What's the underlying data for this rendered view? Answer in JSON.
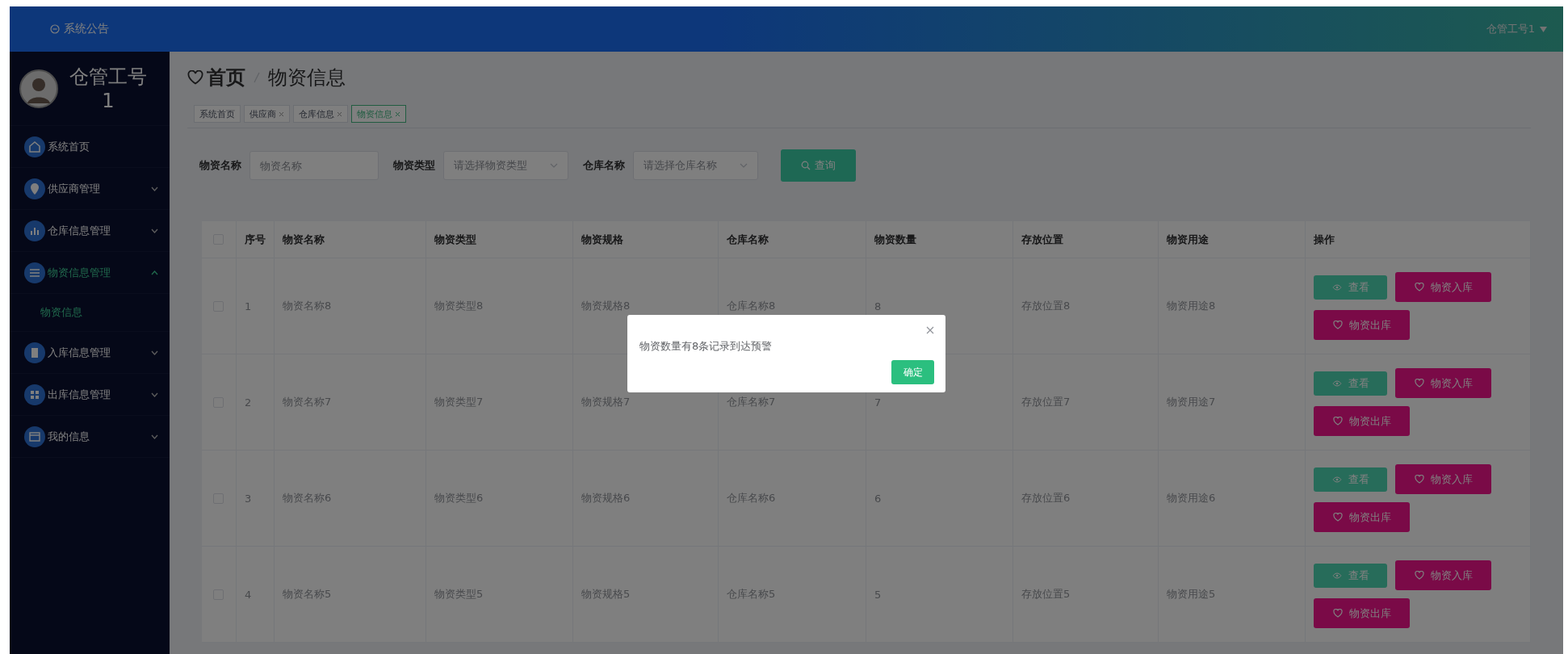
{
  "header": {
    "notice": "系统公告",
    "user_menu": "仓管工号1"
  },
  "sidebar": {
    "user_name": "仓管工号",
    "user_id": "1",
    "items": [
      {
        "label": "系统首页",
        "kind": "link",
        "expanded": false
      },
      {
        "label": "供应商管理",
        "kind": "group",
        "expanded": false
      },
      {
        "label": "仓库信息管理",
        "kind": "group",
        "expanded": false
      },
      {
        "label": "物资信息管理",
        "kind": "group",
        "expanded": true,
        "children": [
          {
            "label": "物资信息",
            "selected": true
          }
        ]
      },
      {
        "label": "入库信息管理",
        "kind": "group",
        "expanded": false
      },
      {
        "label": "出库信息管理",
        "kind": "group",
        "expanded": false
      },
      {
        "label": "我的信息",
        "kind": "group",
        "expanded": false
      }
    ]
  },
  "breadcrumb": [
    "首页",
    "物资信息"
  ],
  "tags": [
    {
      "label": "系统首页",
      "closable": false,
      "selected": false
    },
    {
      "label": "供应商",
      "closable": true,
      "selected": false
    },
    {
      "label": "仓库信息",
      "closable": true,
      "selected": false
    },
    {
      "label": "物资信息",
      "closable": true,
      "selected": true
    }
  ],
  "filters": [
    {
      "label": "物资名称",
      "kind": "input",
      "placeholder": "物资名称"
    },
    {
      "label": "物资类型",
      "kind": "select",
      "placeholder": "请选择物资类型"
    },
    {
      "label": "仓库名称",
      "kind": "select",
      "placeholder": "请选择仓库名称"
    }
  ],
  "search_button": "查询",
  "table": {
    "header_checked": false,
    "columns": [
      "序号",
      "物资名称",
      "物资类型",
      "物资规格",
      "仓库名称",
      "物资数量",
      "存放位置",
      "物资用途",
      "操作"
    ],
    "rows": [
      {
        "checked": false,
        "cells": [
          "1",
          "物资名称8",
          "物资类型8",
          "物资规格8",
          "仓库名称8",
          "8",
          "存放位置8",
          "物资用途8"
        ],
        "actions": [
          {
            "label": "查看",
            "kind": "view"
          },
          {
            "label": "物资入库",
            "kind": "stock"
          },
          {
            "label": "物资出库",
            "kind": "stock"
          }
        ]
      },
      {
        "checked": false,
        "cells": [
          "2",
          "物资名称7",
          "物资类型7",
          "物资规格7",
          "仓库名称7",
          "7",
          "存放位置7",
          "物资用途7"
        ],
        "actions": [
          {
            "label": "查看",
            "kind": "view"
          },
          {
            "label": "物资入库",
            "kind": "stock"
          },
          {
            "label": "物资出库",
            "kind": "stock"
          }
        ]
      },
      {
        "checked": false,
        "cells": [
          "3",
          "物资名称6",
          "物资类型6",
          "物资规格6",
          "仓库名称6",
          "6",
          "存放位置6",
          "物资用途6"
        ],
        "actions": [
          {
            "label": "查看",
            "kind": "view"
          },
          {
            "label": "物资入库",
            "kind": "stock"
          },
          {
            "label": "物资出库",
            "kind": "stock"
          }
        ]
      },
      {
        "checked": false,
        "cells": [
          "4",
          "物资名称5",
          "物资类型5",
          "物资规格5",
          "仓库名称5",
          "5",
          "存放位置5",
          "物资用途5"
        ],
        "actions": [
          {
            "label": "查看",
            "kind": "view"
          },
          {
            "label": "物资入库",
            "kind": "stock"
          },
          {
            "label": "物资出库",
            "kind": "stock"
          }
        ]
      }
    ]
  },
  "dialog": {
    "message": "物资数量有8条记录到达预警",
    "confirm": "确定"
  }
}
